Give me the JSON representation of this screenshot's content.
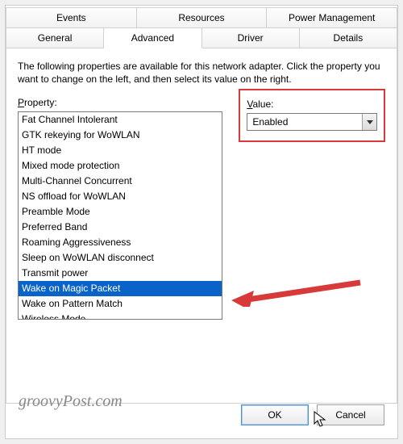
{
  "tabs_top": [
    "Events",
    "Resources",
    "Power Management"
  ],
  "tabs_bottom": [
    "General",
    "Advanced",
    "Driver",
    "Details"
  ],
  "active_tab": "Advanced",
  "description": "The following properties are available for this network adapter. Click the property you want to change on the left, and then select its value on the right.",
  "property_label_pre": "P",
  "property_label_rest": "roperty:",
  "value_label_pre": "V",
  "value_label_rest": "alue:",
  "properties": [
    "Fat Channel Intolerant",
    "GTK rekeying for WoWLAN",
    "HT mode",
    "Mixed mode protection",
    "Multi-Channel Concurrent",
    "NS offload for WoWLAN",
    "Preamble Mode",
    "Preferred Band",
    "Roaming Aggressiveness",
    "Sleep on WoWLAN disconnect",
    "Transmit power",
    "Wake on Magic Packet",
    "Wake on Pattern Match",
    "Wireless Mode"
  ],
  "selected_property_index": 11,
  "value_selected": "Enabled",
  "ok_label": "OK",
  "cancel_label": "Cancel",
  "watermark": "groovyPost.com",
  "highlight_color": "#d83a3a"
}
